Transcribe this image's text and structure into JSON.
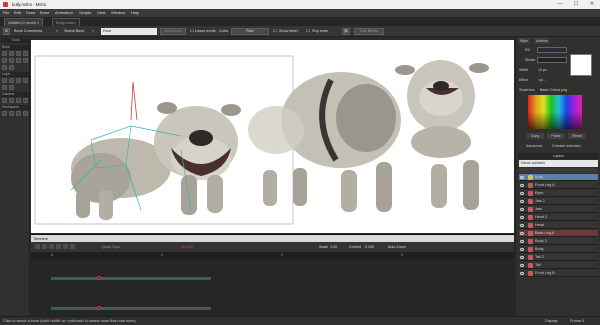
{
  "window": {
    "title": "bully.moho - Moho",
    "controls": [
      "—",
      "☐",
      "✕"
    ]
  },
  "menu": [
    "File",
    "Edit",
    "Draw",
    "Bone",
    "Animation",
    "Scripts",
    "View",
    "Window",
    "Help"
  ],
  "tabs": [
    {
      "label": "Untitled 2.moho ×",
      "active": true
    },
    {
      "label": "Bully.moho",
      "active": false
    }
  ],
  "tool_options": {
    "bone_comments": "Bone Comments",
    "select_bone": "Select Bone",
    "bone_name": "Root",
    "bind_name": "Bind name",
    "lasso_mode": "Lasso mode",
    "color": "Color",
    "color_value": "Plain",
    "show_label": "Show label",
    "shy_bone": "Shy bone",
    "link_bones": "Link Bones"
  },
  "left_panel": {
    "headers": [
      "Tools",
      "Bone",
      "Layer",
      "Camera",
      "Workspace"
    ]
  },
  "timeline": {
    "title": "Timeline",
    "quick_sync": "Quick Sync",
    "smooth": "Smooth",
    "scale_label": "Scale",
    "scale_value": "1.00",
    "current": "Current",
    "current_value": "0.100",
    "auto_zoom": "Auto Zoom",
    "frame_numbers": [
      "0",
      "6",
      "12",
      "18",
      "24",
      "30",
      "36",
      "42",
      "48",
      "54",
      "60",
      "66",
      "72",
      "78",
      "84",
      "90",
      "96",
      "102",
      "108",
      "114",
      "120",
      "126",
      "132",
      "138",
      "144",
      "150",
      "156",
      "162",
      "168",
      "174",
      "180",
      "186",
      "192",
      "198",
      "204",
      "210",
      "216",
      "222",
      "228",
      "234",
      "240"
    ],
    "section_numbers": [
      "1",
      "2",
      "3",
      "4"
    ]
  },
  "right_panel": {
    "tabs": [
      "Style",
      "Actions"
    ],
    "fill_label": "Fill",
    "stroke_label": "Stroke",
    "width_label": "Width",
    "width_value": "10 px",
    "effect_label": "Effect",
    "effect_value": "<pl...",
    "swatches_label": "Swatches",
    "swatches_value": "Basic Colors.png",
    "copy": "Copy",
    "paste": "Paste",
    "reset": "Reset",
    "advanced": "Advanced",
    "checker": "Checker selection",
    "layers_header": "Layers",
    "name_contains": "Name contains",
    "layers": [
      {
        "name": "Bully",
        "type": "group",
        "selected": true
      },
      {
        "name": "Front Leg A",
        "type": "vector"
      },
      {
        "name": "Eyes",
        "type": "vector"
      },
      {
        "name": "Jaw 2",
        "type": "vector"
      },
      {
        "name": "Jaw",
        "type": "vector"
      },
      {
        "name": "Head 2",
        "type": "vector"
      },
      {
        "name": "Head",
        "type": "vector"
      },
      {
        "name": "Back Leg A",
        "type": "vector",
        "highlight": true
      },
      {
        "name": "Body 2",
        "type": "vector"
      },
      {
        "name": "Body",
        "type": "vector"
      },
      {
        "name": "Tail 2",
        "type": "vector"
      },
      {
        "name": "Tail",
        "type": "vector"
      },
      {
        "name": "Front Leg B",
        "type": "vector"
      }
    ]
  },
  "status": {
    "text": "Click to select a bone (hold <shift> or <ctrl/cmd> to select more than one bone)",
    "frame": "Frame 0",
    "display": "Display"
  },
  "colors": {
    "accent_red": "#e33b3b",
    "selected_layer": "#5a7fa8",
    "highlight_layer": "#c45a5a",
    "track": "#3d6b5a"
  }
}
